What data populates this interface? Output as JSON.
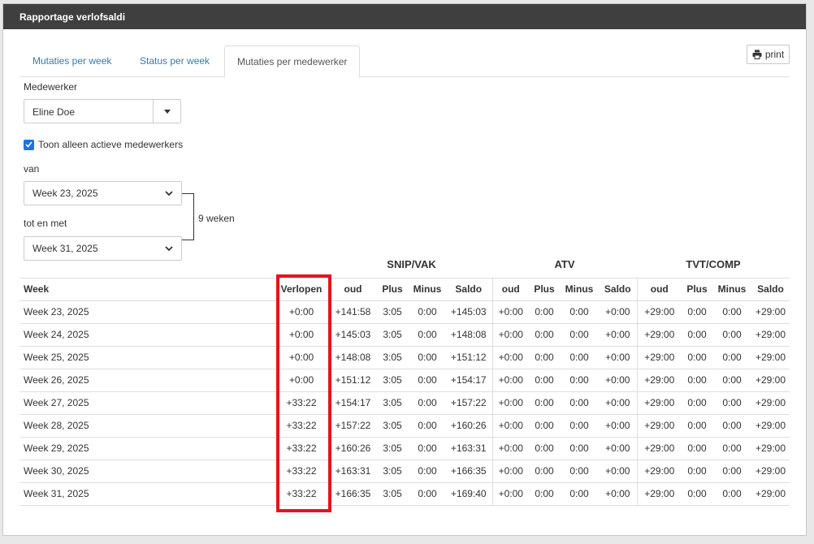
{
  "header": {
    "title": "Rapportage verlofsaldi"
  },
  "print": {
    "label": "print"
  },
  "tabs": [
    {
      "label": "Mutaties per week"
    },
    {
      "label": "Status per week"
    },
    {
      "label": "Mutaties per medewerker"
    }
  ],
  "form": {
    "employee_label": "Medewerker",
    "employee_value": "Eline Doe",
    "active_only_label": "Toon alleen actieve medewerkers",
    "active_only_checked": true,
    "from_label": "van",
    "from_value": "Week 23, 2025",
    "to_label": "tot en met",
    "to_value": "Week 31, 2025",
    "span_text": "9 weken"
  },
  "table": {
    "groups": [
      "SNIP/VAK",
      "ATV",
      "TVT/COMP"
    ],
    "week_header": "Week",
    "expired_header": "Verlopen",
    "sub_headers": [
      "oud",
      "Plus",
      "Minus",
      "Saldo"
    ],
    "rows": [
      {
        "week": "Week 23, 2025",
        "verlopen": "+0:00",
        "snip": [
          "+141:58",
          "3:05",
          "0:00",
          "+145:03"
        ],
        "atv": [
          "+0:00",
          "0:00",
          "0:00",
          "+0:00"
        ],
        "tvt": [
          "+29:00",
          "0:00",
          "0:00",
          "+29:00"
        ]
      },
      {
        "week": "Week 24, 2025",
        "verlopen": "+0:00",
        "snip": [
          "+145:03",
          "3:05",
          "0:00",
          "+148:08"
        ],
        "atv": [
          "+0:00",
          "0:00",
          "0:00",
          "+0:00"
        ],
        "tvt": [
          "+29:00",
          "0:00",
          "0:00",
          "+29:00"
        ]
      },
      {
        "week": "Week 25, 2025",
        "verlopen": "+0:00",
        "snip": [
          "+148:08",
          "3:05",
          "0:00",
          "+151:12"
        ],
        "atv": [
          "+0:00",
          "0:00",
          "0:00",
          "+0:00"
        ],
        "tvt": [
          "+29:00",
          "0:00",
          "0:00",
          "+29:00"
        ]
      },
      {
        "week": "Week 26, 2025",
        "verlopen": "+0:00",
        "snip": [
          "+151:12",
          "3:05",
          "0:00",
          "+154:17"
        ],
        "atv": [
          "+0:00",
          "0:00",
          "0:00",
          "+0:00"
        ],
        "tvt": [
          "+29:00",
          "0:00",
          "0:00",
          "+29:00"
        ]
      },
      {
        "week": "Week 27, 2025",
        "verlopen": "+33:22",
        "snip": [
          "+154:17",
          "3:05",
          "0:00",
          "+157:22"
        ],
        "atv": [
          "+0:00",
          "0:00",
          "0:00",
          "+0:00"
        ],
        "tvt": [
          "+29:00",
          "0:00",
          "0:00",
          "+29:00"
        ]
      },
      {
        "week": "Week 28, 2025",
        "verlopen": "+33:22",
        "snip": [
          "+157:22",
          "3:05",
          "0:00",
          "+160:26"
        ],
        "atv": [
          "+0:00",
          "0:00",
          "0:00",
          "+0:00"
        ],
        "tvt": [
          "+29:00",
          "0:00",
          "0:00",
          "+29:00"
        ]
      },
      {
        "week": "Week 29, 2025",
        "verlopen": "+33:22",
        "snip": [
          "+160:26",
          "3:05",
          "0:00",
          "+163:31"
        ],
        "atv": [
          "+0:00",
          "0:00",
          "0:00",
          "+0:00"
        ],
        "tvt": [
          "+29:00",
          "0:00",
          "0:00",
          "+29:00"
        ]
      },
      {
        "week": "Week 30, 2025",
        "verlopen": "+33:22",
        "snip": [
          "+163:31",
          "3:05",
          "0:00",
          "+166:35"
        ],
        "atv": [
          "+0:00",
          "0:00",
          "0:00",
          "+0:00"
        ],
        "tvt": [
          "+29:00",
          "0:00",
          "0:00",
          "+29:00"
        ]
      },
      {
        "week": "Week 31, 2025",
        "verlopen": "+33:22",
        "snip": [
          "+166:35",
          "3:05",
          "0:00",
          "+169:40"
        ],
        "atv": [
          "+0:00",
          "0:00",
          "0:00",
          "+0:00"
        ],
        "tvt": [
          "+29:00",
          "0:00",
          "0:00",
          "+29:00"
        ]
      }
    ]
  },
  "colors": {
    "highlight": "#e5141d",
    "header_bg": "#3f3f3f",
    "link": "#337ab7",
    "checkbox": "#1a73e8"
  }
}
